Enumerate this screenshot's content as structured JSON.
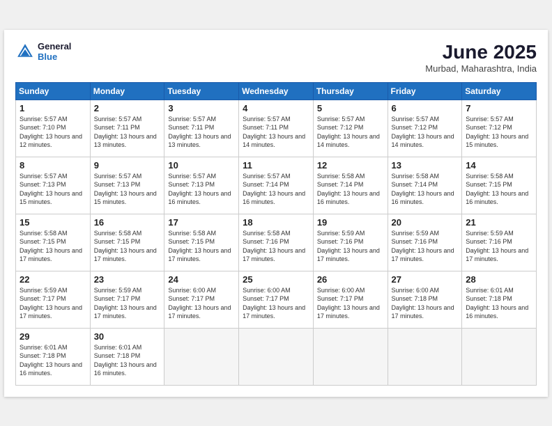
{
  "header": {
    "logo": {
      "general": "General",
      "blue": "Blue"
    },
    "title": "June 2025",
    "location": "Murbad, Maharashtra, India"
  },
  "weekdays": [
    "Sunday",
    "Monday",
    "Tuesday",
    "Wednesday",
    "Thursday",
    "Friday",
    "Saturday"
  ],
  "weeks": [
    [
      {
        "day": "1",
        "sunrise": "5:57 AM",
        "sunset": "7:10 PM",
        "daylight": "13 hours and 12 minutes."
      },
      {
        "day": "2",
        "sunrise": "5:57 AM",
        "sunset": "7:11 PM",
        "daylight": "13 hours and 13 minutes."
      },
      {
        "day": "3",
        "sunrise": "5:57 AM",
        "sunset": "7:11 PM",
        "daylight": "13 hours and 13 minutes."
      },
      {
        "day": "4",
        "sunrise": "5:57 AM",
        "sunset": "7:11 PM",
        "daylight": "13 hours and 14 minutes."
      },
      {
        "day": "5",
        "sunrise": "5:57 AM",
        "sunset": "7:12 PM",
        "daylight": "13 hours and 14 minutes."
      },
      {
        "day": "6",
        "sunrise": "5:57 AM",
        "sunset": "7:12 PM",
        "daylight": "13 hours and 14 minutes."
      },
      {
        "day": "7",
        "sunrise": "5:57 AM",
        "sunset": "7:12 PM",
        "daylight": "13 hours and 15 minutes."
      }
    ],
    [
      {
        "day": "8",
        "sunrise": "5:57 AM",
        "sunset": "7:13 PM",
        "daylight": "13 hours and 15 minutes."
      },
      {
        "day": "9",
        "sunrise": "5:57 AM",
        "sunset": "7:13 PM",
        "daylight": "13 hours and 15 minutes."
      },
      {
        "day": "10",
        "sunrise": "5:57 AM",
        "sunset": "7:13 PM",
        "daylight": "13 hours and 16 minutes."
      },
      {
        "day": "11",
        "sunrise": "5:57 AM",
        "sunset": "7:14 PM",
        "daylight": "13 hours and 16 minutes."
      },
      {
        "day": "12",
        "sunrise": "5:58 AM",
        "sunset": "7:14 PM",
        "daylight": "13 hours and 16 minutes."
      },
      {
        "day": "13",
        "sunrise": "5:58 AM",
        "sunset": "7:14 PM",
        "daylight": "13 hours and 16 minutes."
      },
      {
        "day": "14",
        "sunrise": "5:58 AM",
        "sunset": "7:15 PM",
        "daylight": "13 hours and 16 minutes."
      }
    ],
    [
      {
        "day": "15",
        "sunrise": "5:58 AM",
        "sunset": "7:15 PM",
        "daylight": "13 hours and 17 minutes."
      },
      {
        "day": "16",
        "sunrise": "5:58 AM",
        "sunset": "7:15 PM",
        "daylight": "13 hours and 17 minutes."
      },
      {
        "day": "17",
        "sunrise": "5:58 AM",
        "sunset": "7:15 PM",
        "daylight": "13 hours and 17 minutes."
      },
      {
        "day": "18",
        "sunrise": "5:58 AM",
        "sunset": "7:16 PM",
        "daylight": "13 hours and 17 minutes."
      },
      {
        "day": "19",
        "sunrise": "5:59 AM",
        "sunset": "7:16 PM",
        "daylight": "13 hours and 17 minutes."
      },
      {
        "day": "20",
        "sunrise": "5:59 AM",
        "sunset": "7:16 PM",
        "daylight": "13 hours and 17 minutes."
      },
      {
        "day": "21",
        "sunrise": "5:59 AM",
        "sunset": "7:16 PM",
        "daylight": "13 hours and 17 minutes."
      }
    ],
    [
      {
        "day": "22",
        "sunrise": "5:59 AM",
        "sunset": "7:17 PM",
        "daylight": "13 hours and 17 minutes."
      },
      {
        "day": "23",
        "sunrise": "5:59 AM",
        "sunset": "7:17 PM",
        "daylight": "13 hours and 17 minutes."
      },
      {
        "day": "24",
        "sunrise": "6:00 AM",
        "sunset": "7:17 PM",
        "daylight": "13 hours and 17 minutes."
      },
      {
        "day": "25",
        "sunrise": "6:00 AM",
        "sunset": "7:17 PM",
        "daylight": "13 hours and 17 minutes."
      },
      {
        "day": "26",
        "sunrise": "6:00 AM",
        "sunset": "7:17 PM",
        "daylight": "13 hours and 17 minutes."
      },
      {
        "day": "27",
        "sunrise": "6:00 AM",
        "sunset": "7:18 PM",
        "daylight": "13 hours and 17 minutes."
      },
      {
        "day": "28",
        "sunrise": "6:01 AM",
        "sunset": "7:18 PM",
        "daylight": "13 hours and 16 minutes."
      }
    ],
    [
      {
        "day": "29",
        "sunrise": "6:01 AM",
        "sunset": "7:18 PM",
        "daylight": "13 hours and 16 minutes."
      },
      {
        "day": "30",
        "sunrise": "6:01 AM",
        "sunset": "7:18 PM",
        "daylight": "13 hours and 16 minutes."
      },
      null,
      null,
      null,
      null,
      null
    ]
  ]
}
